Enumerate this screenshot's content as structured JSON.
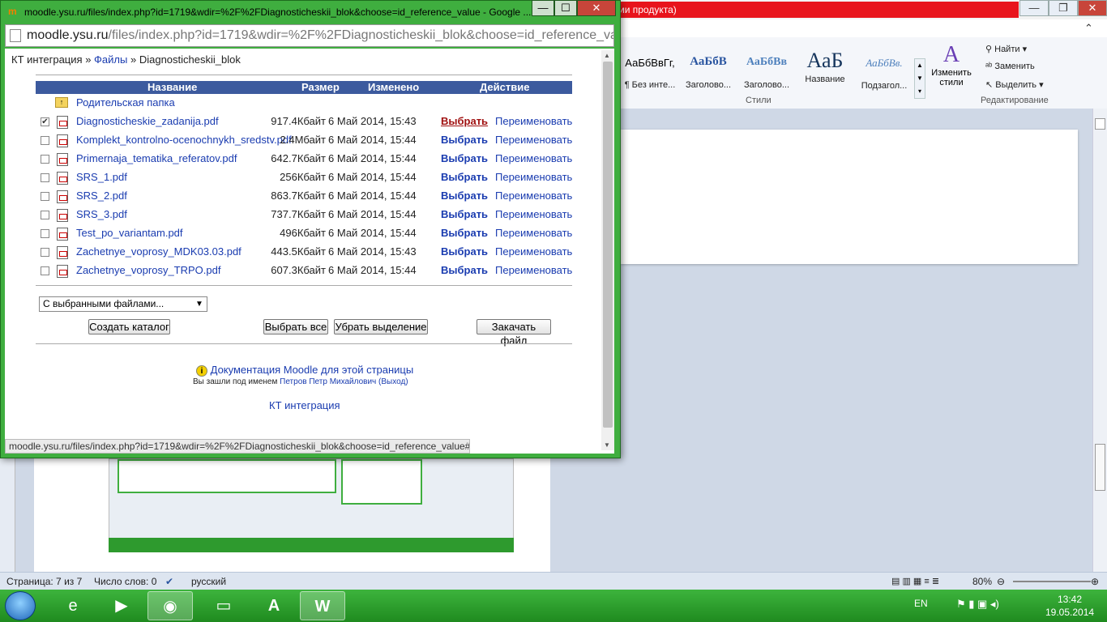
{
  "popup": {
    "title": "moodle.ysu.ru/files/index.php?id=1719&wdir=%2F%2FDiagnosticheskii_blok&choose=id_reference_value - Google ...",
    "address_host": "moodle.ysu.ru",
    "address_path": "/files/index.php?id=1719&wdir=%2F%2FDiagnosticheskii_blok&choose=id_reference_val",
    "status_url": "moodle.ysu.ru/files/index.php?id=1719&wdir=%2F%2FDiagnosticheskii_blok&choose=id_reference_value#",
    "controls": {
      "minimize": "—",
      "maximize": "☐",
      "close": "✕"
    }
  },
  "breadcrumb": {
    "course": "КТ интеграция",
    "sep1": "»",
    "files": "Файлы",
    "sep2": "»",
    "folder": "Diagnosticheskii_blok"
  },
  "table": {
    "headers": {
      "name": "Название",
      "size": "Размер",
      "modified": "Изменено",
      "action": "Действие"
    },
    "parent_folder": "Родительская папка",
    "select_label": "Выбрать",
    "rename_label": "Переименовать",
    "rows": [
      {
        "name": "Diagnosticheskie_zadanija.pdf",
        "size": "917.4Кбайт",
        "date": "6 Май 2014, 15:43",
        "checked": true
      },
      {
        "name": "Komplekt_kontrolno-ocenochnykh_sredstv.pdf",
        "size": "2.4Мбайт",
        "date": "6 Май 2014, 15:44",
        "checked": false
      },
      {
        "name": "Primernaja_tematika_referatov.pdf",
        "size": "642.7Кбайт",
        "date": "6 Май 2014, 15:44",
        "checked": false
      },
      {
        "name": "SRS_1.pdf",
        "size": "256Кбайт",
        "date": "6 Май 2014, 15:44",
        "checked": false
      },
      {
        "name": "SRS_2.pdf",
        "size": "863.7Кбайт",
        "date": "6 Май 2014, 15:44",
        "checked": false
      },
      {
        "name": "SRS_3.pdf",
        "size": "737.7Кбайт",
        "date": "6 Май 2014, 15:44",
        "checked": false
      },
      {
        "name": "Test_po_variantam.pdf",
        "size": "496Кбайт",
        "date": "6 Май 2014, 15:44",
        "checked": false
      },
      {
        "name": "Zachetnye_voprosy_MDK03.03.pdf",
        "size": "443.5Кбайт",
        "date": "6 Май 2014, 15:43",
        "checked": false
      },
      {
        "name": "Zachetnye_voprosy_TRPO.pdf",
        "size": "607.3Кбайт",
        "date": "6 Май 2014, 15:44",
        "checked": false
      }
    ]
  },
  "actions": {
    "with_selected": "С выбранными файлами...",
    "create_folder": "Создать каталог",
    "select_all": "Выбрать все",
    "deselect": "Убрать выделение",
    "upload": "Закачать файл"
  },
  "footer": {
    "doc_link": "Документация Moodle для этой страницы",
    "logged_in_prefix": "Вы зашли под именем",
    "user_name": "Петров Петр Михайлович",
    "logout": "(Выход)",
    "course_link": "КТ интеграция"
  },
  "word": {
    "title_strip": "ии продукта)",
    "styles": [
      {
        "sample": "АаБбВвГг,",
        "name": "¶ Без инте..."
      },
      {
        "sample": "АаБбВ",
        "name": "Заголово..."
      },
      {
        "sample": "АаБбВв",
        "name": "Заголово..."
      },
      {
        "sample": "АаБ",
        "name": "Название"
      },
      {
        "sample": "АаБбВв.",
        "name": "Подзагол..."
      }
    ],
    "change_styles": "Изменить стили",
    "group_styles": "Стили",
    "group_edit": "Редактирование",
    "find": "Найти",
    "replace": "Заменить",
    "select": "Выделить",
    "status": {
      "page": "Страница: 7 из 7",
      "words": "Число слов: 0",
      "lang": "русский",
      "zoom": "80%"
    }
  },
  "taskbar": {
    "lang": "EN",
    "time": "13:42",
    "date": "19.05.2014"
  }
}
